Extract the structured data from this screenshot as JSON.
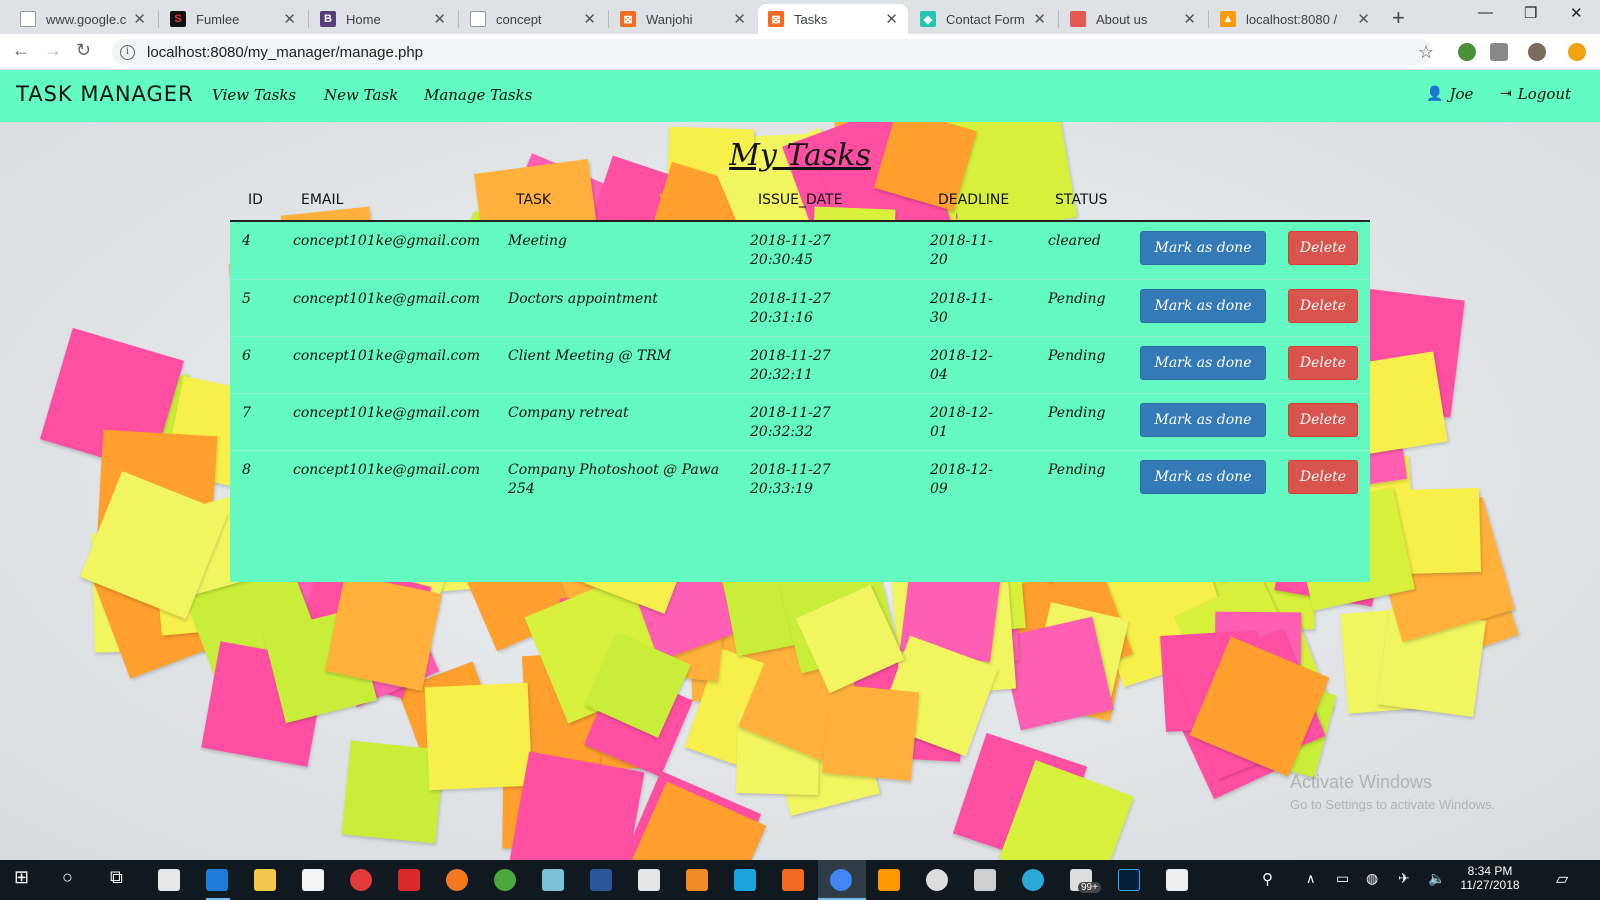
{
  "browser": {
    "tabs": [
      {
        "title": "www.google.co",
        "icon": "page-icon",
        "color": "#ffffff"
      },
      {
        "title": "Fumlee",
        "icon": "fumlee-favicon",
        "color": "#111111"
      },
      {
        "title": "Home",
        "icon": "bootstrap-favicon",
        "color": "#563d7c"
      },
      {
        "title": "concept",
        "icon": "page-icon",
        "color": "#ffffff"
      },
      {
        "title": "Wanjohi",
        "icon": "wanjohi-favicon",
        "color": "#f36b21"
      },
      {
        "title": "Tasks",
        "icon": "tasks-favicon",
        "color": "#f36b21"
      },
      {
        "title": "Contact Form",
        "icon": "contact-favicon",
        "color": "#26c6b0"
      },
      {
        "title": "About us",
        "icon": "about-favicon",
        "color": "#e5584f"
      },
      {
        "title": "localhost:8080 /",
        "icon": "phpmyadmin-favicon",
        "color": "#f89c0e"
      }
    ],
    "url": "localhost:8080/my_manager/manage.php"
  },
  "app": {
    "brand": "TASK MANAGER",
    "nav": [
      "View Tasks",
      "New Task",
      "Manage Tasks"
    ],
    "user": "Joe",
    "logout": "Logout"
  },
  "heading": "My Tasks",
  "table": {
    "headers": [
      "ID",
      "EMAIL",
      "TASK",
      "ISSUE_DATE",
      "DEADLINE",
      "STATUS"
    ],
    "done_label": "Mark as done",
    "delete_label": "Delete",
    "rows": [
      {
        "id": "4",
        "email": "concept101ke@gmail.com",
        "task": "Meeting",
        "issue_date": "2018-11-27",
        "issue_time": "20:30:45",
        "deadline_a": "2018-11-",
        "deadline_b": "20",
        "status": "cleared"
      },
      {
        "id": "5",
        "email": "concept101ke@gmail.com",
        "task": "Doctors appointment",
        "issue_date": "2018-11-27",
        "issue_time": "20:31:16",
        "deadline_a": "2018-11-",
        "deadline_b": "30",
        "status": "Pending"
      },
      {
        "id": "6",
        "email": "concept101ke@gmail.com",
        "task": "Client Meeting @ TRM",
        "issue_date": "2018-11-27",
        "issue_time": "20:32:11",
        "deadline_a": "2018-12-",
        "deadline_b": "04",
        "status": "Pending"
      },
      {
        "id": "7",
        "email": "concept101ke@gmail.com",
        "task": "Company retreat",
        "issue_date": "2018-11-27",
        "issue_time": "20:32:32",
        "deadline_a": "2018-12-",
        "deadline_b": "01",
        "status": "Pending"
      },
      {
        "id": "8",
        "email": "concept101ke@gmail.com",
        "task": "Company Photoshoot @ Pawa",
        "task_b": "254",
        "issue_date": "2018-11-27",
        "issue_time": "20:33:19",
        "deadline_a": "2018-12-",
        "deadline_b": "09",
        "status": "Pending"
      }
    ]
  },
  "watermark": {
    "title": "Activate Windows",
    "sub": "Go to Settings to activate Windows."
  },
  "taskbar": {
    "time": "8:34 PM",
    "date": "11/27/2018",
    "badge": "99+"
  },
  "colors": {
    "nav_bg": "#62fbc2",
    "table_bg": "#63f9c0",
    "done_btn": "#337ab7",
    "delete_btn": "#d9534f"
  }
}
